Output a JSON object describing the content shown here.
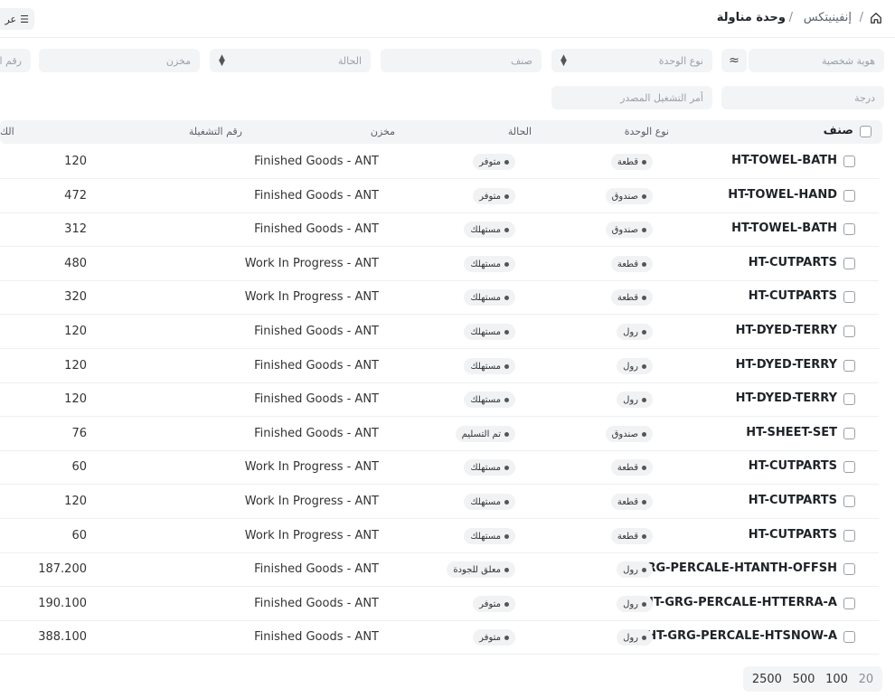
{
  "breadcrumb": {
    "parent": "إنفينيتكس",
    "separator": "/",
    "current": "وحدة مناولة"
  },
  "header": {
    "menu_label": "عر"
  },
  "filters": {
    "id_placeholder": "هوية شخصية",
    "unit_type_placeholder": "نوع الوحدة",
    "item_placeholder": "صنف",
    "status_placeholder": "الحالة",
    "warehouse_placeholder": "مخزن",
    "batch_placeholder": "رقم الت",
    "grade_placeholder": "درجة",
    "source_wo_placeholder": "أمر التشغيل المصدر"
  },
  "table": {
    "columns": {
      "item": "صنف",
      "unit_type": "نوع الوحدة",
      "status": "الحالة",
      "warehouse": "مخزن",
      "batch": "رقم التشغيلة",
      "qty": "الك"
    },
    "rows": [
      {
        "item": "HT-TOWEL-BATH",
        "unit_type": "قطعة",
        "status": "متوفر",
        "warehouse": "Finished Goods - ANT",
        "qty": "120"
      },
      {
        "item": "HT-TOWEL-HAND",
        "unit_type": "صندوق",
        "status": "متوفر",
        "warehouse": "Finished Goods - ANT",
        "qty": "472"
      },
      {
        "item": "HT-TOWEL-BATH",
        "unit_type": "صندوق",
        "status": "مستهلك",
        "warehouse": "Finished Goods - ANT",
        "qty": "312"
      },
      {
        "item": "HT-CUTPARTS",
        "unit_type": "قطعة",
        "status": "مستهلك",
        "warehouse": "Work In Progress - ANT",
        "qty": "480"
      },
      {
        "item": "HT-CUTPARTS",
        "unit_type": "قطعة",
        "status": "مستهلك",
        "warehouse": "Work In Progress - ANT",
        "qty": "320"
      },
      {
        "item": "HT-DYED-TERRY",
        "unit_type": "رول",
        "status": "مستهلك",
        "warehouse": "Finished Goods - ANT",
        "qty": "120"
      },
      {
        "item": "HT-DYED-TERRY",
        "unit_type": "رول",
        "status": "مستهلك",
        "warehouse": "Finished Goods - ANT",
        "qty": "120"
      },
      {
        "item": "HT-DYED-TERRY",
        "unit_type": "رول",
        "status": "مستهلك",
        "warehouse": "Finished Goods - ANT",
        "qty": "120"
      },
      {
        "item": "HT-SHEET-SET",
        "unit_type": "صندوق",
        "status": "تم التسليم",
        "warehouse": "Finished Goods - ANT",
        "qty": "76"
      },
      {
        "item": "HT-CUTPARTS",
        "unit_type": "قطعة",
        "status": "مستهلك",
        "warehouse": "Work In Progress - ANT",
        "qty": "60"
      },
      {
        "item": "HT-CUTPARTS",
        "unit_type": "قطعة",
        "status": "مستهلك",
        "warehouse": "Work In Progress - ANT",
        "qty": "120"
      },
      {
        "item": "HT-CUTPARTS",
        "unit_type": "قطعة",
        "status": "مستهلك",
        "warehouse": "Work In Progress - ANT",
        "qty": "60"
      },
      {
        "item": "RG-PERCALE-HTANTH-OFFSH",
        "unit_type": "رول",
        "status": "معلق للجودة",
        "warehouse": "Finished Goods - ANT",
        "qty": "187.200"
      },
      {
        "item": "IT-GRG-PERCALE-HTTERRA-A",
        "unit_type": "رول",
        "status": "متوفر",
        "warehouse": "Finished Goods - ANT",
        "qty": "190.100"
      },
      {
        "item": "HT-GRG-PERCALE-HTSNOW-A",
        "unit_type": "رول",
        "status": "متوفر",
        "warehouse": "Finished Goods - ANT",
        "qty": "388.100"
      }
    ]
  },
  "pagination": [
    "2500",
    "500",
    "100",
    "20"
  ],
  "icons": {
    "home": "home-icon",
    "menu": "list-icon",
    "filter_toggle": "approx-icon",
    "chevron": "updown-chevron-icon"
  }
}
